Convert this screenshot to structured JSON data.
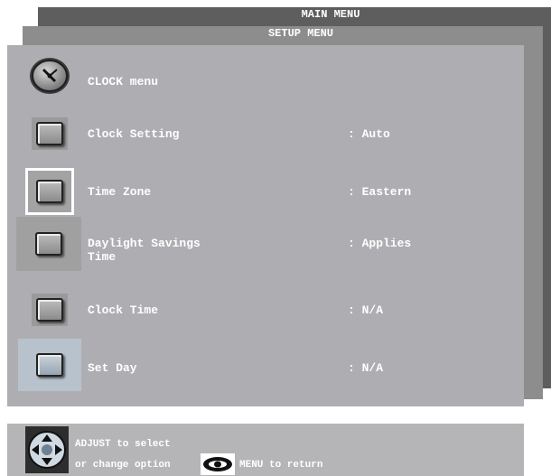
{
  "main_menu": {
    "title": "MAIN MENU"
  },
  "setup_menu": {
    "title": "SETUP MENU"
  },
  "clock_menu": {
    "header_label": "CLOCK menu",
    "header_icon": "clock-icon",
    "rows": [
      {
        "label": "Clock Setting",
        "value": ": Auto",
        "icon": "square-button-icon"
      },
      {
        "label": "Time Zone",
        "value": ": Eastern",
        "icon": "square-button-icon",
        "selected": true
      },
      {
        "label": "Daylight Savings",
        "label2": "Time",
        "value": ": Applies",
        "icon": "square-button-icon"
      },
      {
        "label": "Clock Time",
        "value": ": N/A",
        "icon": "square-button-icon"
      },
      {
        "label": "Set Day",
        "value": ": N/A",
        "icon": "square-button-icon"
      }
    ]
  },
  "footer": {
    "line1": "ADJUST to select",
    "line2_prefix": "or change option",
    "line2_suffix": "MENU to return",
    "adjust_icon": "dpad-icon",
    "menu_icon": "eye-menu-icon"
  },
  "colors": {
    "main_panel": "#5e5e5e",
    "setup_panel": "#8d8d8d",
    "clock_panel": "#aeaeb2",
    "selection": "#ffffff"
  }
}
